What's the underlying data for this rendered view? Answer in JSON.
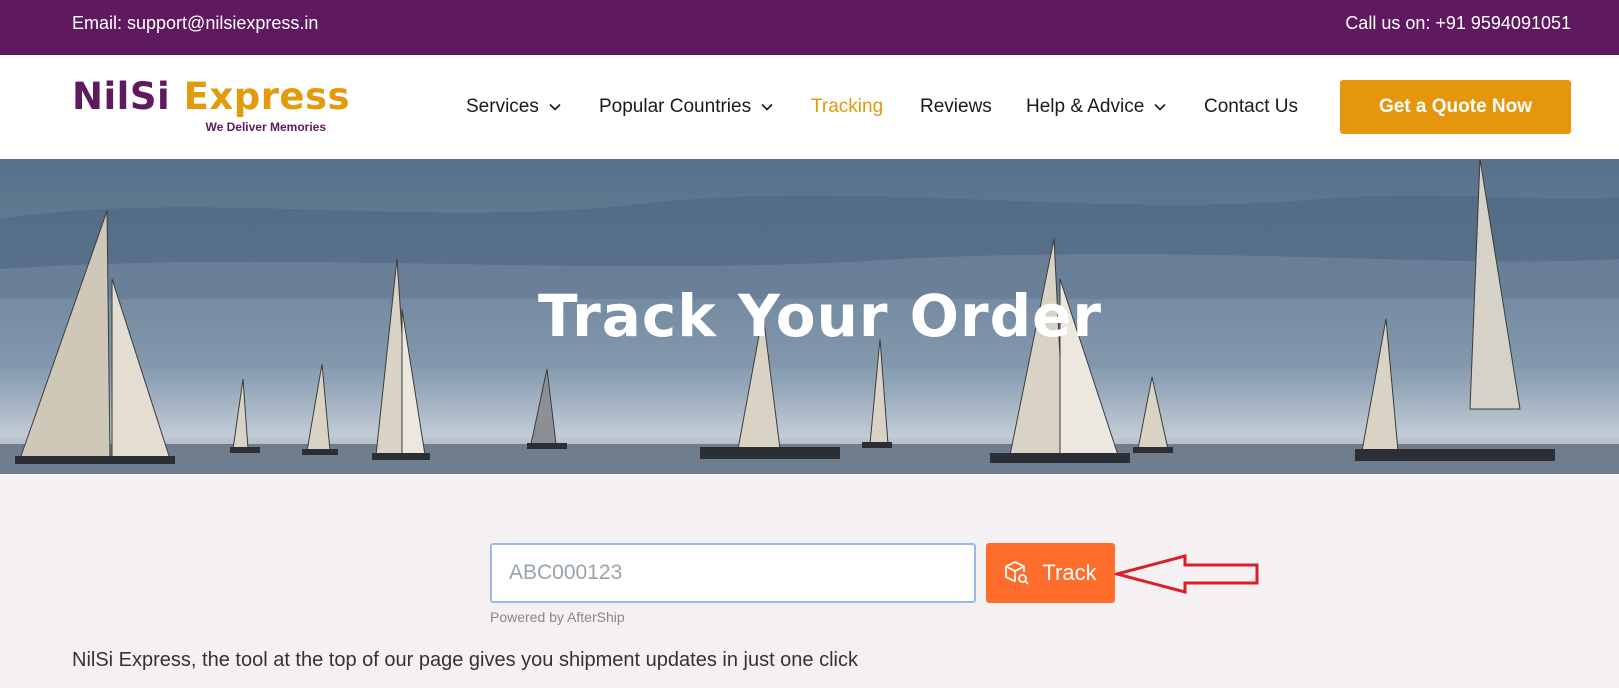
{
  "topbar": {
    "email": "Email: support@nilsiexpress.in",
    "phone": "Call us on: +91 9594091051"
  },
  "logo": {
    "brand_part1": "NilSi",
    "brand_part2": "Express",
    "tagline": "We Deliver Memories"
  },
  "nav": {
    "items": [
      {
        "label": "Services",
        "dropdown": true
      },
      {
        "label": "Popular Countries",
        "dropdown": true
      },
      {
        "label": "Tracking",
        "dropdown": false,
        "active": true
      },
      {
        "label": "Reviews",
        "dropdown": false
      },
      {
        "label": "Help & Advice",
        "dropdown": true
      },
      {
        "label": "Contact Us",
        "dropdown": false
      }
    ],
    "cta": "Get a Quote Now"
  },
  "hero": {
    "title": "Track Your Order"
  },
  "tracking": {
    "input_value": "ABC000123",
    "button_label": "Track",
    "powered_by": "Powered by AfterShip"
  },
  "description": "NilSi Express, the tool at the top of our page gives you shipment updates in just one click",
  "colors": {
    "brand_purple": "#5e195f",
    "brand_orange": "#e39b0b",
    "track_button": "#fe6d2c",
    "arrow_red": "#d9202a"
  }
}
